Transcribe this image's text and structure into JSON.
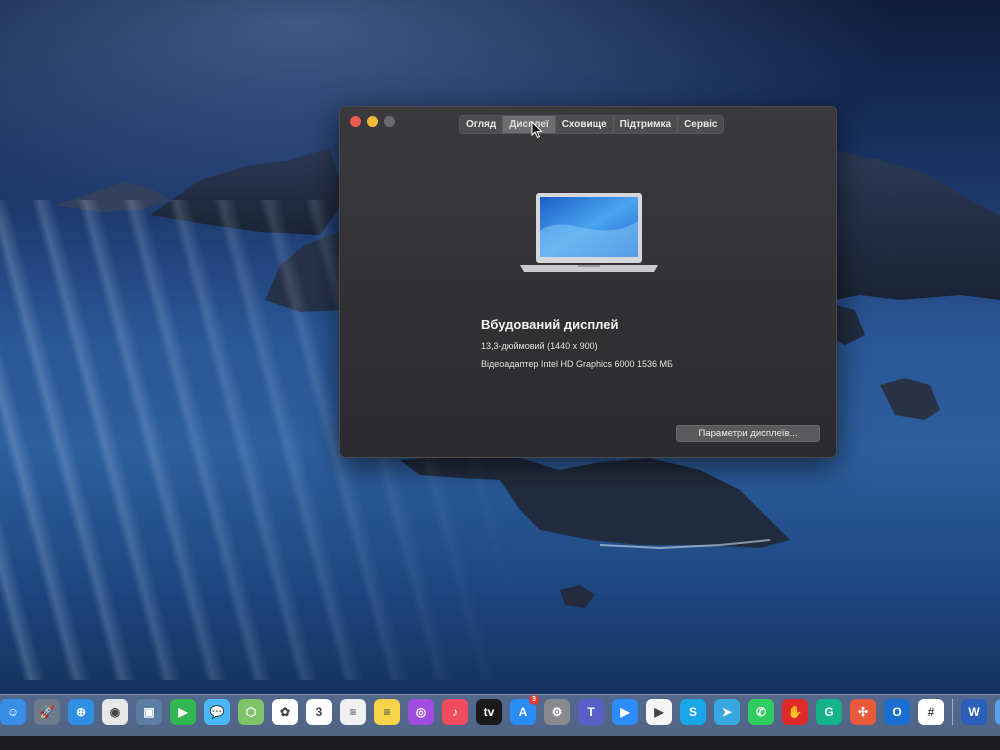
{
  "window": {
    "tabs": [
      {
        "label": "Огляд"
      },
      {
        "label": "Дисплеї"
      },
      {
        "label": "Сховище"
      },
      {
        "label": "Підтримка"
      },
      {
        "label": "Сервіс"
      }
    ],
    "active_tab": "Дисплеї",
    "display_name": "Вбудований дисплей",
    "display_size": "13,3-дюймовий (1440 x 900)",
    "graphics": "Відеоадаптер Intel HD Graphics 6000 1536 МБ",
    "params_button": "Параметри дисплеїв..."
  },
  "dock": {
    "items": [
      {
        "name": "finder-icon",
        "color": "#3a8ee8",
        "glyph": "☺"
      },
      {
        "name": "launchpad-icon",
        "color": "#6c7a8c",
        "glyph": "🚀"
      },
      {
        "name": "safari-icon",
        "color": "#2f8fe0",
        "glyph": "⊕"
      },
      {
        "name": "chrome-icon",
        "color": "#e8e8e8",
        "glyph": "◉"
      },
      {
        "name": "preview-icon",
        "color": "#5d7ea3",
        "glyph": "▣"
      },
      {
        "name": "facetime-icon",
        "color": "#33b554",
        "glyph": "▶"
      },
      {
        "name": "messages-icon",
        "color": "#47b7f5",
        "glyph": "💬"
      },
      {
        "name": "maps-icon",
        "color": "#7cc36a",
        "glyph": "⬡"
      },
      {
        "name": "photos-icon",
        "color": "#ffffff",
        "glyph": "✿"
      },
      {
        "name": "calendar-icon",
        "color": "#ffffff",
        "glyph": "3"
      },
      {
        "name": "reminders-icon",
        "color": "#f0f0f0",
        "glyph": "≡"
      },
      {
        "name": "notes-icon",
        "color": "#f5d44a",
        "glyph": "≡"
      },
      {
        "name": "podcasts-icon",
        "color": "#9e4de0",
        "glyph": "◎"
      },
      {
        "name": "music-icon",
        "color": "#f04c5e",
        "glyph": "♪"
      },
      {
        "name": "tv-icon",
        "color": "#1a1a1a",
        "glyph": "tv"
      },
      {
        "name": "app-store-icon",
        "color": "#2a8cf5",
        "glyph": "A",
        "badge": "3"
      },
      {
        "name": "system-preferences-icon",
        "color": "#8a8a8e",
        "glyph": "⚙"
      },
      {
        "name": "teams-icon",
        "color": "#5a5fc7",
        "glyph": "T"
      },
      {
        "name": "zoom-icon",
        "color": "#2d8cff",
        "glyph": "▶"
      },
      {
        "name": "meet-icon",
        "color": "#f5f5f5",
        "glyph": "▶"
      },
      {
        "name": "skype-icon",
        "color": "#1aa5e6",
        "glyph": "S"
      },
      {
        "name": "telegram-icon",
        "color": "#3aa8e0",
        "glyph": "➤"
      },
      {
        "name": "whatsapp-icon",
        "color": "#2fcc5f",
        "glyph": "✆"
      },
      {
        "name": "adblock-icon",
        "color": "#e02a2a",
        "glyph": "✋"
      },
      {
        "name": "grammarly-icon",
        "color": "#16b28a",
        "glyph": "G"
      },
      {
        "name": "quilt-icon",
        "color": "#e85a3a",
        "glyph": "✣"
      },
      {
        "name": "outlook-icon",
        "color": "#1a6fd0",
        "glyph": "O"
      },
      {
        "name": "slack-icon",
        "color": "#ffffff",
        "glyph": "#"
      },
      {
        "name": "word-icon",
        "color": "#2b5fba",
        "glyph": "W"
      },
      {
        "name": "folder-icon",
        "color": "#5aa0e8",
        "glyph": "▭"
      }
    ]
  }
}
